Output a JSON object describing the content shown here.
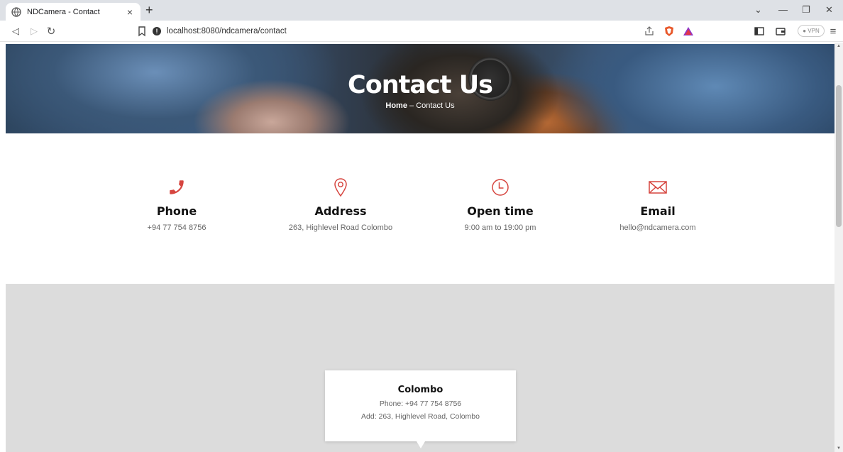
{
  "browser": {
    "tab_title": "NDCamera - Contact",
    "tab_close": "×",
    "new_tab": "+",
    "url": "localhost:8080/ndcamera/contact",
    "vpn_label": "● VPN",
    "accent": "#d6453f"
  },
  "hero": {
    "title": "Contact Us",
    "breadcrumb_home": "Home",
    "breadcrumb_sep": " – ",
    "breadcrumb_current": "Contact Us"
  },
  "contact_info": [
    {
      "icon": "phone-icon",
      "title": "Phone",
      "value": "+94 77 754 8756"
    },
    {
      "icon": "map-pin-icon",
      "title": "Address",
      "value": "263, Highlevel Road Colombo"
    },
    {
      "icon": "clock-icon",
      "title": "Open time",
      "value": "9:00 am to 19:00 pm"
    },
    {
      "icon": "mail-icon",
      "title": "Email",
      "value": "hello@ndcamera.com"
    }
  ],
  "map_popup": {
    "title": "Colombo",
    "phone": "Phone: +94 77 754 8756",
    "address": "Add: 263, Highlevel Road, Colombo"
  }
}
